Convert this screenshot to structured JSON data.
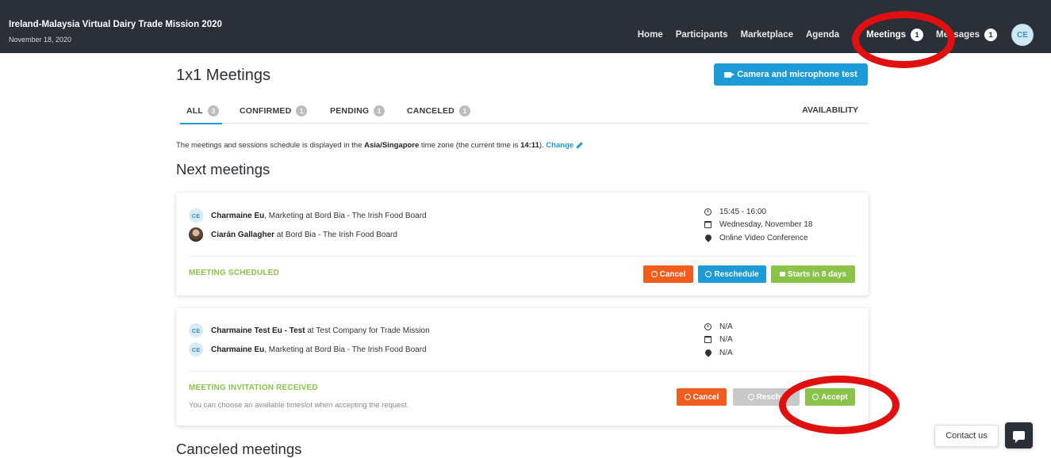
{
  "app": {
    "title": "Ireland-Malaysia Virtual Dairy Trade Mission 2020",
    "date": "November 18, 2020"
  },
  "nav": {
    "items": [
      {
        "label": "Home"
      },
      {
        "label": "Participants"
      },
      {
        "label": "Marketplace"
      },
      {
        "label": "Agenda"
      },
      {
        "label": "Meetings",
        "badge": "1"
      },
      {
        "label": "Messages",
        "badge": "1"
      }
    ],
    "avatar_initials": "CE"
  },
  "page": {
    "title": "1x1 Meetings",
    "camera_test_label": "Camera and microphone test"
  },
  "tabs": [
    {
      "label": "ALL",
      "count": "3"
    },
    {
      "label": "CONFIRMED",
      "count": "1"
    },
    {
      "label": "PENDING",
      "count": "1"
    },
    {
      "label": "CANCELED",
      "count": "1"
    }
  ],
  "availability_label": "AVAILABILITY",
  "timezone_note": {
    "prefix": "The meetings and sessions schedule is displayed in the ",
    "zone": "Asia/Singapore",
    "middle": " time zone (the current time is ",
    "time": "14:11",
    "suffix": "). ",
    "change_label": "Change"
  },
  "next_meetings_title": "Next meetings",
  "meetings": [
    {
      "participants": [
        {
          "initials": "CE",
          "name": "Charmaine Eu",
          "rest": ", Marketing at Bord Bia - The Irish Food Board"
        },
        {
          "initials": "",
          "name": "Ciarán Gallagher",
          "rest": " at Bord Bia - The Irish Food Board"
        }
      ],
      "time": "15:45 - 16:00",
      "date": "Wednesday, November 18",
      "location": "Online Video Conference",
      "status": "MEETING SCHEDULED",
      "buttons": {
        "cancel": "Cancel",
        "reschedule": "Reschedule",
        "starts": "Starts in 8 days"
      }
    },
    {
      "participants": [
        {
          "initials": "CE",
          "name": "Charmaine Test Eu - Test",
          "rest": " at Test Company for Trade Mission"
        },
        {
          "initials": "CE",
          "name": "Charmaine Eu",
          "rest": ", Marketing at Bord Bia - The Irish Food Board"
        }
      ],
      "time": "N/A",
      "date": "N/A",
      "location": "N/A",
      "status": "MEETING INVITATION RECEIVED",
      "status_sub": "You can choose an available timeslot when accepting the request.",
      "buttons": {
        "cancel": "Cancel",
        "reschedule": "Resche",
        "accept": "Accept"
      }
    }
  ],
  "canceled_title": "Canceled meetings",
  "contact_label": "Contact us",
  "colors": {
    "topbar": "#2b2f38",
    "accent_blue": "#1e9ad6",
    "cancel_orange": "#f25c1e",
    "green": "#8bc34a",
    "annotation_red": "#e01010"
  }
}
